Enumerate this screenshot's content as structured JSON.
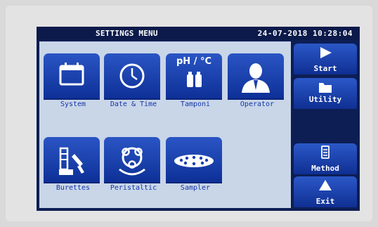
{
  "header": {
    "title": "SETTINGS MENU",
    "datetime": "24-07-2018 10:28:04"
  },
  "tiles": [
    {
      "label": "System",
      "icon": "calendar-icon"
    },
    {
      "label": "Date & Time",
      "icon": "clock-icon"
    },
    {
      "label": "Tamponi",
      "icon": "buffer-bottles-icon",
      "icon_text": "pH / °C"
    },
    {
      "label": "Operator",
      "icon": "operator-icon"
    },
    {
      "label": "Burettes",
      "icon": "burette-icon"
    },
    {
      "label": "Peristaltic",
      "icon": "peristaltic-pump-icon"
    },
    {
      "label": "Sampler",
      "icon": "sampler-tray-icon"
    }
  ],
  "sidebar": {
    "start_label": "Start",
    "utility_label": "Utility",
    "method_label": "Method",
    "exit_label": "Exit"
  },
  "colors": {
    "screen_bg": "#0d1e55",
    "panel_bg": "#c9d6e8",
    "tile_blue": "#1a3fb0",
    "label_blue": "#1436a8"
  }
}
